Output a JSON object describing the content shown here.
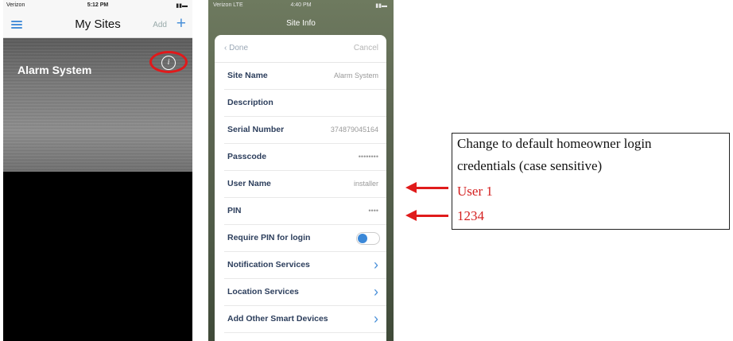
{
  "phone1": {
    "status": {
      "carrier": "Verizon",
      "time": "5:12 PM"
    },
    "nav": {
      "title": "My Sites",
      "add_label": "Add",
      "plus": "+"
    },
    "site": {
      "name": "Alarm System",
      "info_glyph": "i"
    }
  },
  "phone2": {
    "status": {
      "carrier": "Verizon LTE",
      "time": "4:40 PM"
    },
    "title": "Site Info",
    "top": {
      "done": "Done",
      "cancel": "Cancel"
    },
    "rows": [
      {
        "label": "Site Name",
        "value": "Alarm System"
      },
      {
        "label": "Description",
        "value": ""
      },
      {
        "label": "Serial Number",
        "value": "374879045164"
      },
      {
        "label": "Passcode",
        "value": "••••••••"
      },
      {
        "label": "User Name",
        "value": "installer"
      },
      {
        "label": "PIN",
        "value": "••••"
      },
      {
        "label": "Require PIN for login",
        "toggle_on": true
      },
      {
        "label": "Notification Services"
      },
      {
        "label": "Location Services"
      },
      {
        "label": "Add Other Smart Devices"
      }
    ]
  },
  "callout": {
    "line1": "Change to default homeowner login",
    "line2": "credentials (case sensitive)",
    "user": "User 1",
    "pin": "1234",
    "highlight_color": "#e01b1b"
  }
}
